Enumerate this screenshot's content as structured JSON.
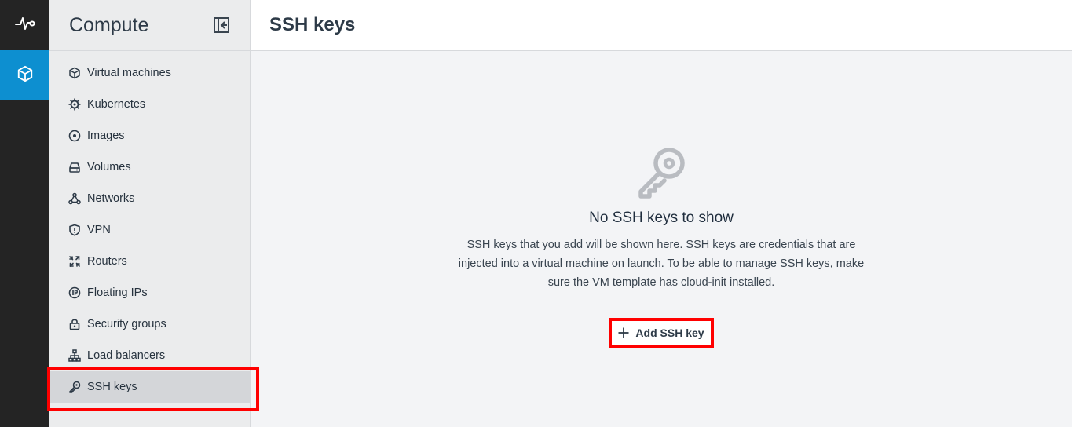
{
  "rail": {
    "items": [
      {
        "icon": "activity-icon"
      },
      {
        "icon": "cube-icon",
        "active": true
      }
    ]
  },
  "sidebar": {
    "title": "Compute",
    "items": [
      {
        "label": "Virtual machines",
        "icon": "cube-icon"
      },
      {
        "label": "Kubernetes",
        "icon": "kubernetes-icon"
      },
      {
        "label": "Images",
        "icon": "disc-icon"
      },
      {
        "label": "Volumes",
        "icon": "drive-icon"
      },
      {
        "label": "Networks",
        "icon": "network-icon"
      },
      {
        "label": "VPN",
        "icon": "shield-icon"
      },
      {
        "label": "Routers",
        "icon": "router-icon"
      },
      {
        "label": "Floating IPs",
        "icon": "floating-ip-icon"
      },
      {
        "label": "Security groups",
        "icon": "lock-icon"
      },
      {
        "label": "Load balancers",
        "icon": "load-balancer-icon"
      },
      {
        "label": "SSH keys",
        "icon": "key-icon",
        "active": true
      }
    ]
  },
  "main": {
    "title": "SSH keys",
    "empty_state": {
      "title": "No SSH keys to show",
      "description": "SSH keys that you add will be shown here. SSH keys are credentials that are injected into a virtual machine on launch. To be able to manage SSH keys, make sure the VM template has cloud-init installed.",
      "button_label": "Add SSH key"
    }
  },
  "colors": {
    "rail_bg": "#242424",
    "rail_active": "#0d8fd0",
    "highlight": "#ff0000"
  }
}
